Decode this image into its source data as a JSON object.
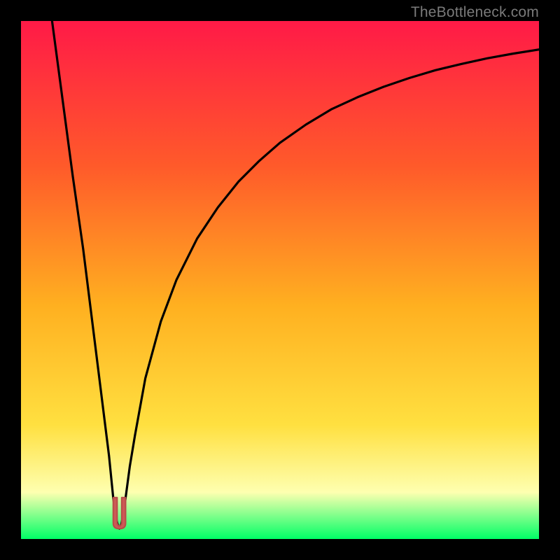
{
  "watermark": "TheBottleneck.com",
  "colors": {
    "page_bg": "#000000",
    "gradient_top": "#ff1a47",
    "gradient_mid1": "#ff5a2a",
    "gradient_mid2": "#ffb020",
    "gradient_mid3": "#ffe040",
    "gradient_pale": "#feffb0",
    "gradient_bottom": "#00ff66",
    "curve": "#000000",
    "marker_fill": "#cc5a55",
    "marker_stroke": "#b84c48"
  },
  "chart_data": {
    "type": "line",
    "title": "",
    "xlabel": "",
    "ylabel": "",
    "xlim": [
      0,
      100
    ],
    "ylim": [
      0,
      100
    ],
    "optimum_x": 19,
    "series": [
      {
        "name": "bottleneck-curve",
        "x": [
          6,
          8,
          10,
          12,
          14,
          15,
          16,
          17,
          17.8,
          18.2,
          18.6,
          19,
          19.4,
          19.8,
          20.2,
          21,
          22,
          24,
          27,
          30,
          34,
          38,
          42,
          46,
          50,
          55,
          60,
          65,
          70,
          75,
          80,
          85,
          90,
          95,
          100
        ],
        "y": [
          100,
          85,
          70,
          56,
          40,
          32,
          24,
          16,
          8,
          5,
          3,
          2,
          3,
          5,
          8,
          14,
          20,
          31,
          42,
          50,
          58,
          64,
          69,
          73,
          76.5,
          80,
          83,
          85.3,
          87.3,
          89,
          90.5,
          91.7,
          92.8,
          93.7,
          94.5
        ]
      }
    ],
    "marker": {
      "name": "optimal-point",
      "shape": "u",
      "x_range": [
        17.8,
        20.2
      ],
      "y_bottom": 2,
      "y_top": 8
    }
  }
}
